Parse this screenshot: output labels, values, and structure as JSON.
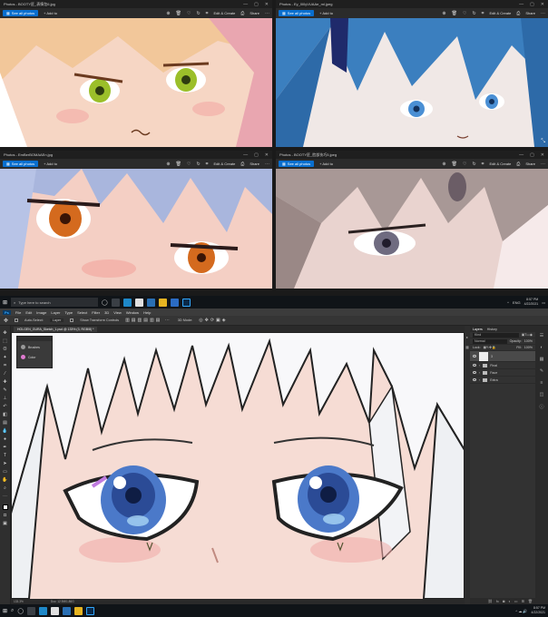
{
  "photo_windows": [
    {
      "title": "Photos - BOOTY匠_表情包6.jpg",
      "see_all": "See all photos",
      "add_to": "+ Add to",
      "edit_create": "Edit & Create",
      "share": "Share"
    },
    {
      "title": "Photos - Ey_0l0yVUAAe_ml.jpeg",
      "see_all": "See all photos",
      "add_to": "+ Add to",
      "edit_create": "Edit & Create",
      "share": "Share"
    },
    {
      "title": "Photos - EmBerBOMAAEn.jpg",
      "see_all": "See all photos",
      "add_to": "+ Add to",
      "edit_create": "Edit & Create",
      "share": "Share"
    },
    {
      "title": "Photos - BOOTY匠_脸部技巧5.jpeg",
      "see_all": "See all photos",
      "add_to": "+ Add to",
      "edit_create": "Edit & Create",
      "share": "Share"
    }
  ],
  "taskbar_top": {
    "search": "Type here to search",
    "lang": "ENG",
    "time": "8:57 PM",
    "date": "4/22/2021"
  },
  "taskbar_bottom": {
    "time": "8:57 PM",
    "date": "4/22/2021"
  },
  "photoshop": {
    "menu": [
      "File",
      "Edit",
      "Image",
      "Layer",
      "Type",
      "Select",
      "Filter",
      "3D",
      "View",
      "Window",
      "Help"
    ],
    "options": {
      "auto_select": "Auto-Select:",
      "layer": "Layer",
      "transform": "Show Transform Controls",
      "mode3d": "3D Mode:"
    },
    "doc_tab": "HOLGEN_GURA_Sketch_1.psd @ 133% (3, RGB/8) *",
    "flyout": [
      "Brushes",
      "Color"
    ],
    "status": {
      "zoom": "133.3%",
      "doc": "Doc: 12.9M/1.86G"
    },
    "layers_panel": {
      "tabs": [
        "Layers",
        "History"
      ],
      "kind": "Kind",
      "blend": "Normal",
      "opacity_label": "Opacity:",
      "opacity": "100%",
      "lock_label": "Lock:",
      "fill_label": "Fill:",
      "fill": "100%",
      "layers": [
        "3",
        "Final",
        "Face",
        "Extra"
      ]
    }
  }
}
